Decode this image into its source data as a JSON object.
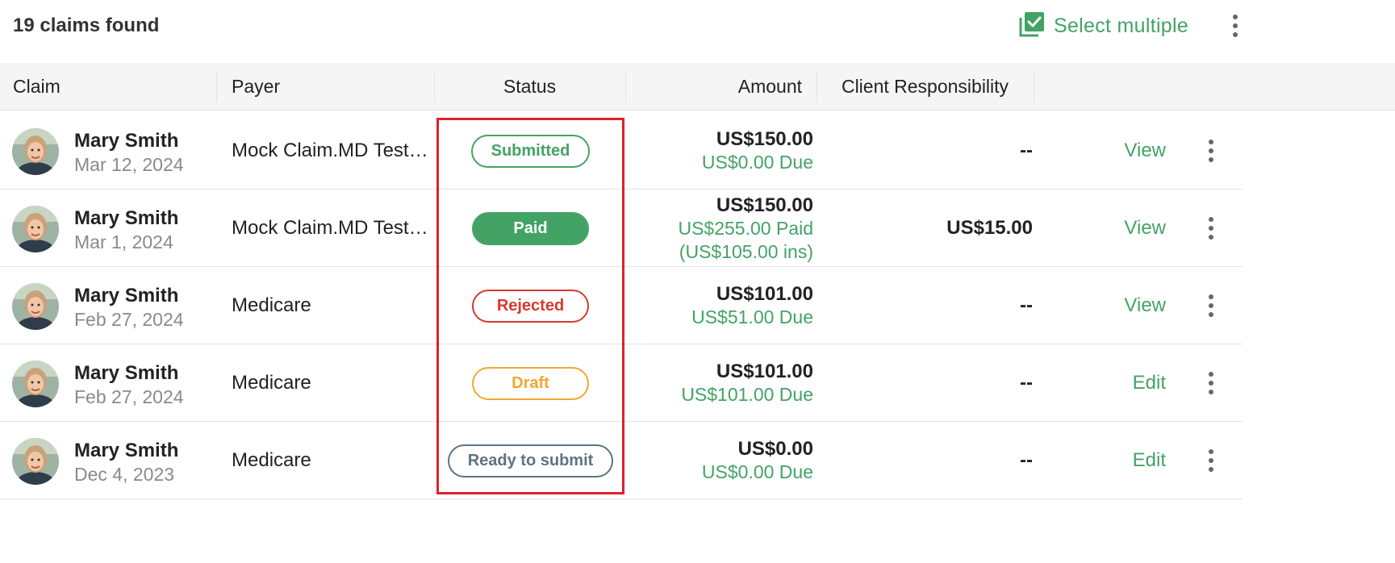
{
  "header": {
    "claims_count": "19 claims found",
    "select_multiple_label": "Select multiple",
    "select_multiple_icon": "select-multiple-icon",
    "more_icon": "more-vert-icon"
  },
  "table": {
    "columns": [
      "Claim",
      "Payer",
      "Status",
      "Amount",
      "Client Responsibility"
    ],
    "rows": [
      {
        "name": "Mary Smith",
        "date": "Mar 12, 2024",
        "payer": "Mock Claim.MD Test…",
        "status": "Submitted",
        "amount": "US$150.00",
        "amount_lines": [
          "US$0.00 Due"
        ],
        "client_responsibility": "--",
        "action": "View"
      },
      {
        "name": "Mary Smith",
        "date": "Mar 1, 2024",
        "payer": "Mock Claim.MD Test…",
        "status": "Paid",
        "amount": "US$150.00",
        "amount_lines": [
          "US$255.00 Paid",
          "(US$105.00 ins)"
        ],
        "client_responsibility": "US$15.00",
        "action": "View"
      },
      {
        "name": "Mary Smith",
        "date": "Feb 27, 2024",
        "payer": "Medicare",
        "status": "Rejected",
        "amount": "US$101.00",
        "amount_lines": [
          "US$51.00 Due"
        ],
        "client_responsibility": "--",
        "action": "View"
      },
      {
        "name": "Mary Smith",
        "date": "Feb 27, 2024",
        "payer": "Medicare",
        "status": "Draft",
        "amount": "US$101.00",
        "amount_lines": [
          "US$101.00 Due"
        ],
        "client_responsibility": "--",
        "action": "Edit"
      },
      {
        "name": "Mary Smith",
        "date": "Dec 4, 2023",
        "payer": "Medicare",
        "status": "Ready to submit",
        "amount": "US$0.00",
        "amount_lines": [
          "US$0.00 Due"
        ],
        "client_responsibility": "--",
        "action": "Edit"
      }
    ]
  },
  "colors": {
    "accent_green": "#43a365",
    "rejected_red": "#d63a2f",
    "draft_orange": "#f2a732",
    "ready_slate": "#5f7382",
    "highlight_red": "#e0202a"
  }
}
